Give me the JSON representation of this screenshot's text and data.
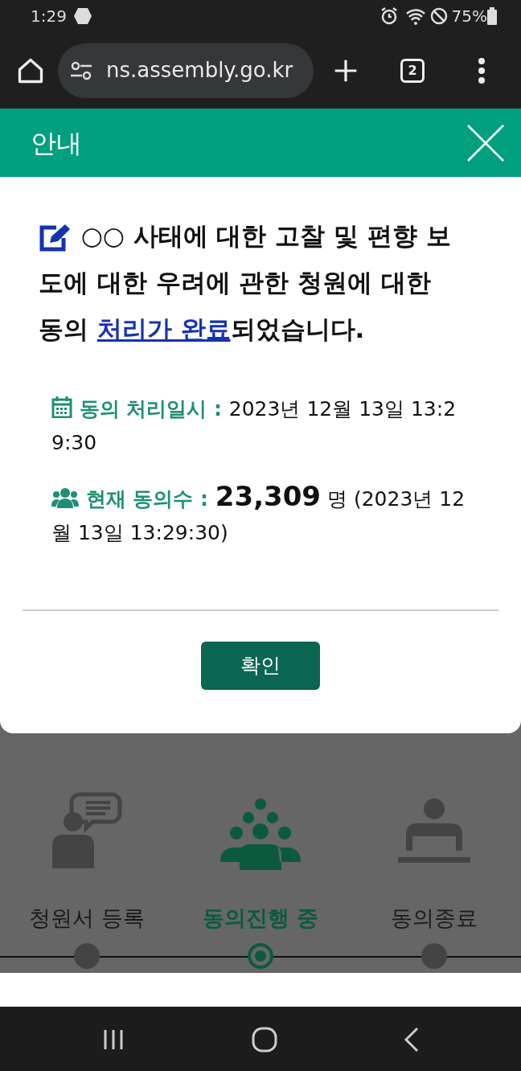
{
  "status_bar": {
    "time": "1:29",
    "battery": "75%"
  },
  "browser": {
    "url": "ns.assembly.go.kr",
    "tab_count": "2"
  },
  "modal": {
    "title": "안내",
    "message_before": "○○ 사태에 대한 고찰 및 편향 보도에 대한 우려에 관한 청원에 대한 동의 ",
    "message_link": "처리가 완료",
    "message_after": "되었습니다.",
    "details": [
      {
        "kind": "date",
        "label": "동의 처리일시 :",
        "value": "2023년 12월 13일 13:29:30"
      },
      {
        "kind": "count",
        "label": "현재 동의수 :",
        "count": "23,309",
        "unit": "명",
        "note": "(2023년 12월 13일 13:29:30)"
      }
    ],
    "confirm_button": "확인"
  },
  "steps": [
    {
      "kind": "register",
      "label": "청원서 등록",
      "selected": false
    },
    {
      "kind": "progress",
      "label": "동의진행 중",
      "selected": true
    },
    {
      "kind": "closed",
      "label": "동의종료",
      "selected": false
    }
  ]
}
